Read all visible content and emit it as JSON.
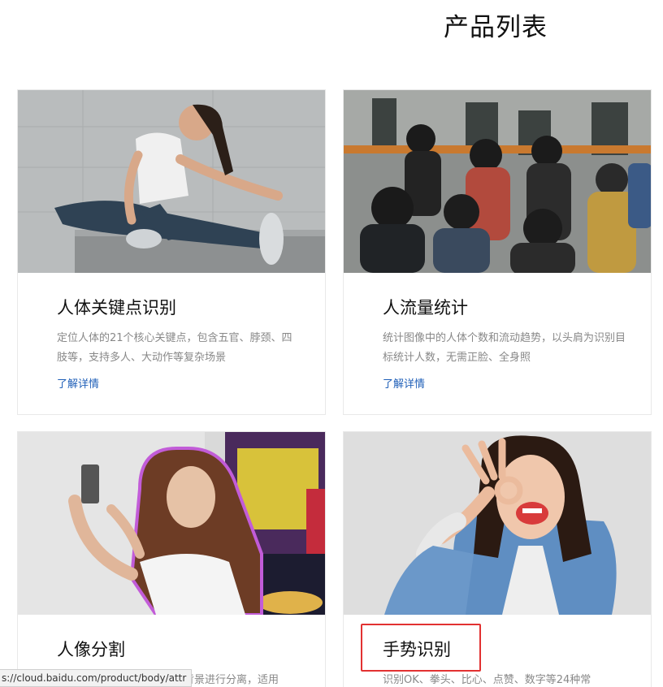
{
  "page": {
    "title": "产品列表"
  },
  "products": [
    {
      "title": "人体关键点识别",
      "desc": "定位人体的21个核心关键点，包含五官、脖颈、四肢等，支持多人、大动作等复杂场景",
      "link": "了解详情"
    },
    {
      "title": "人流量统计",
      "desc": "统计图像中的人体个数和流动趋势，以头肩为识别目标统计人数，无需正脸、全身照",
      "link": "了解详情"
    },
    {
      "title": "人像分割",
      "desc": "背景进行分离，适用"
    },
    {
      "title": "手势识别",
      "desc": "识别OK、拳头、比心、点赞、数字等24种常"
    }
  ],
  "status_bar": {
    "url": "s://cloud.baidu.com/product/body/attr"
  },
  "colors": {
    "link": "#1f5fb8",
    "highlight": "#e23131",
    "title": "#111111",
    "desc": "#888888"
  }
}
